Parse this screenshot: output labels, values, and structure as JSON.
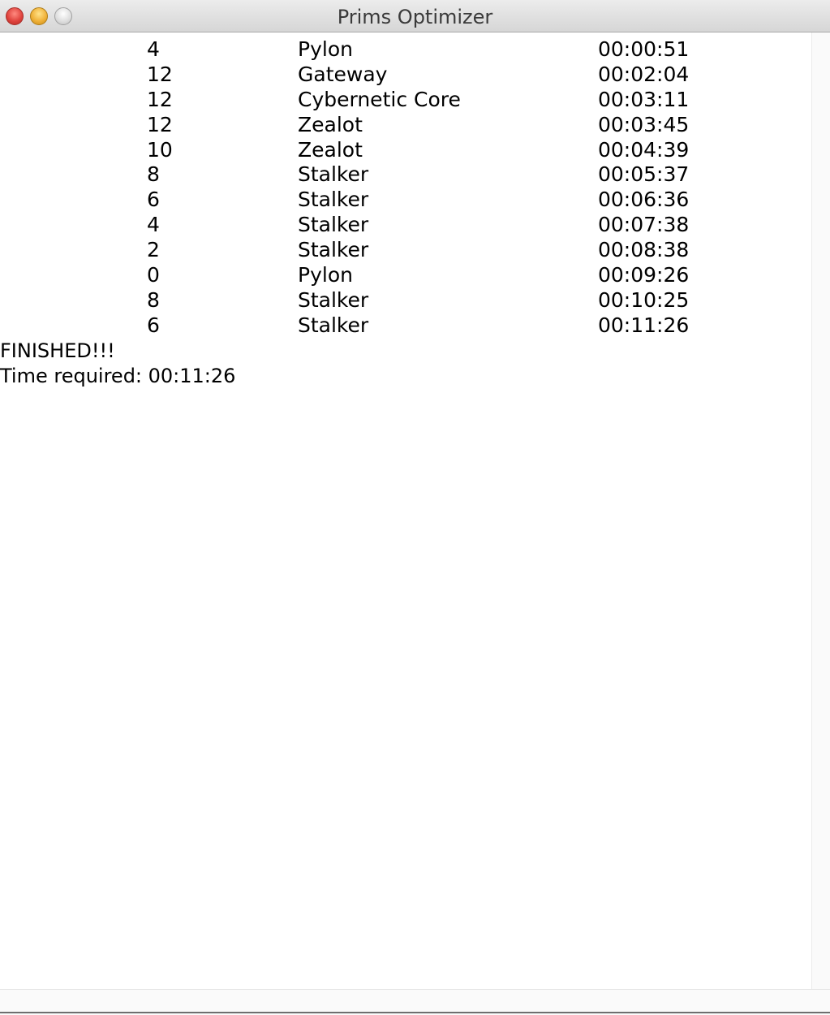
{
  "window": {
    "title": "Prims Optimizer"
  },
  "build_order": [
    {
      "supply": "4",
      "unit": "Pylon",
      "time": "00:00:51"
    },
    {
      "supply": "12",
      "unit": "Gateway",
      "time": "00:02:04"
    },
    {
      "supply": "12",
      "unit": "Cybernetic Core",
      "time": "00:03:11"
    },
    {
      "supply": "12",
      "unit": "Zealot",
      "time": "00:03:45"
    },
    {
      "supply": "10",
      "unit": "Zealot",
      "time": "00:04:39"
    },
    {
      "supply": "8",
      "unit": "Stalker",
      "time": "00:05:37"
    },
    {
      "supply": "6",
      "unit": "Stalker",
      "time": "00:06:36"
    },
    {
      "supply": "4",
      "unit": "Stalker",
      "time": "00:07:38"
    },
    {
      "supply": "2",
      "unit": "Stalker",
      "time": "00:08:38"
    },
    {
      "supply": "0",
      "unit": "Pylon",
      "time": "00:09:26"
    },
    {
      "supply": "8",
      "unit": "Stalker",
      "time": "00:10:25"
    },
    {
      "supply": "6",
      "unit": "Stalker",
      "time": "00:11:26"
    }
  ],
  "status": {
    "finished_text": "FINISHED!!!",
    "time_required_text": "Time required: 00:11:26"
  }
}
